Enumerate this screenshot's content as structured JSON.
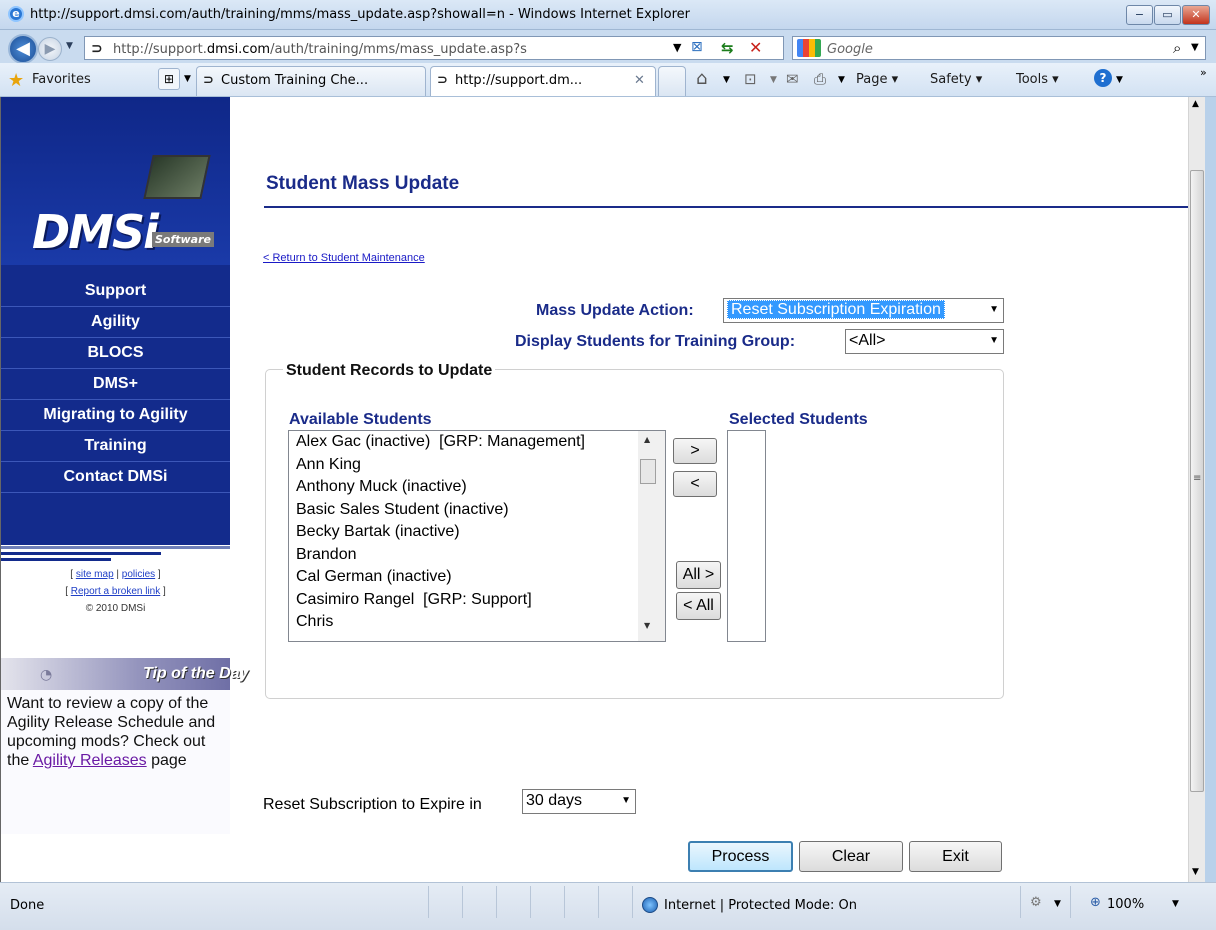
{
  "window": {
    "title": "http://support.dmsi.com/auth/training/mms/mass_update.asp?showall=n - Windows Internet Explorer",
    "controls": {
      "minimize": "−",
      "maximize": "▭",
      "close": "✕"
    }
  },
  "toolbar": {
    "address_prefix": "http://support.",
    "address_domain": "dmsi.com",
    "address_suffix": "/auth/training/mms/mass_update.asp?s",
    "search_placeholder": "Google",
    "back_glyph": "◀",
    "forward_glyph": "▶"
  },
  "favorites_bar": {
    "favorites_label": "Favorites",
    "tabs": [
      {
        "label": "Custom Training Che..."
      },
      {
        "label": "http://support.dm...",
        "close": "✕"
      }
    ],
    "commands": {
      "page": "Page",
      "safety": "Safety",
      "tools": "Tools"
    }
  },
  "sidebar": {
    "logo_text": "DMSi",
    "logo_sub": "Software",
    "nav_items": [
      {
        "label": "Support"
      },
      {
        "label": "Agility"
      },
      {
        "label": "BLOCS"
      },
      {
        "label": "DMS+"
      },
      {
        "label": "Migrating to Agility"
      },
      {
        "label": "Training"
      },
      {
        "label": "Contact DMSi"
      }
    ],
    "footer": {
      "site_map": "site map",
      "policies": "policies",
      "broken_link": "Report a broken link",
      "copyright": "© 2010 DMSi"
    },
    "tip": {
      "title": "Tip of the Day",
      "text_before": "Want to review a copy of the Agility Release Schedule and upcoming mods? Check out the ",
      "link": "Agility Releases",
      "text_after": " page"
    }
  },
  "main": {
    "heading": "Student Mass Update",
    "return_link": "< Return to Student Maintenance",
    "action_label": "Mass Update Action:",
    "action_value": "Reset Subscription Expiration",
    "group_label": "Display Students for Training Group:",
    "group_value": "<All>",
    "fieldset_legend": "Student Records to Update",
    "available_label": "Available Students",
    "selected_label": "Selected Students",
    "available_students": [
      "Alex Gac (inactive)  [GRP: Management]",
      "Ann King",
      "Anthony Muck (inactive)",
      "Basic Sales Student (inactive)",
      "Becky Bartak (inactive)",
      "Brandon",
      "Cal German (inactive)",
      "Casimiro Rangel  [GRP: Support]",
      "Chris"
    ],
    "move_buttons": {
      "add": ">",
      "remove": "<",
      "add_all": "All >",
      "remove_all": "< All"
    },
    "expire_label": "Reset Subscription to Expire in",
    "expire_value": "30 days",
    "buttons": {
      "process": "Process",
      "clear": "Clear",
      "exit": "Exit"
    }
  },
  "statusbar": {
    "status": "Done",
    "zone": "Internet | Protected Mode: On",
    "zoom": "100%"
  }
}
